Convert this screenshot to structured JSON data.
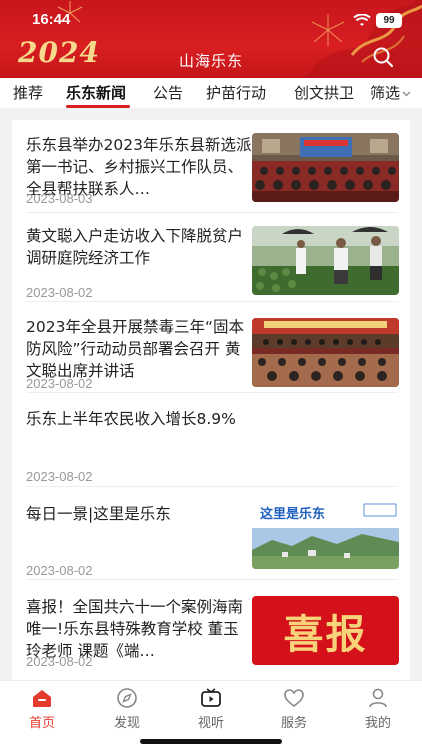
{
  "status": {
    "time": "16:44",
    "battery": "99"
  },
  "header": {
    "year_logo": "2024",
    "title": "山海乐东"
  },
  "tabs": [
    {
      "label": "推荐"
    },
    {
      "label": "乐东新闻",
      "active": true
    },
    {
      "label": "公告"
    },
    {
      "label": "护苗行动"
    },
    {
      "label": "创文拱卫"
    }
  ],
  "filter_label": "筛选",
  "news": [
    {
      "title": "乐东县举办2023年乐东县新选派第一书记、乡村振兴工作队员、全县帮扶联系人…",
      "date": "2023-08-03",
      "thumb": "meeting-hall-photo"
    },
    {
      "title": "黄文聪入户走访收入下降脱贫户 调研庭院经济工作",
      "date": "2023-08-02",
      "thumb": "field-visit-photo"
    },
    {
      "title": "2023年全县开展禁毒三年“固本防风险”行动动员部署会召开 黄文聪出席并讲话",
      "date": "2023-08-02",
      "thumb": "conference-photo"
    },
    {
      "title": "乐东上半年农民收入增长8.9%",
      "date": "2023-08-02"
    },
    {
      "title": "每日一景|这里是乐东",
      "date": "2023-08-02",
      "thumb": "landscape-banner",
      "banner_text": "这里是乐东"
    },
    {
      "title": "喜报！全国共六十一个案例海南唯一!乐东县特殊教育学校 董玉玲老师 课题《端…",
      "date": "2023-08-02",
      "thumb": "good-news-poster",
      "poster_text": "喜报"
    }
  ],
  "bottom_nav": [
    {
      "label": "首页",
      "icon": "home-icon",
      "active": true
    },
    {
      "label": "发现",
      "icon": "compass-icon"
    },
    {
      "label": "视听",
      "icon": "tv-play-icon"
    },
    {
      "label": "服务",
      "icon": "heart-icon"
    },
    {
      "label": "我的",
      "icon": "user-icon"
    }
  ],
  "colors": {
    "brand_red": "#d81e21",
    "active_nav": "#e33b2e",
    "date_gray": "#999999"
  }
}
